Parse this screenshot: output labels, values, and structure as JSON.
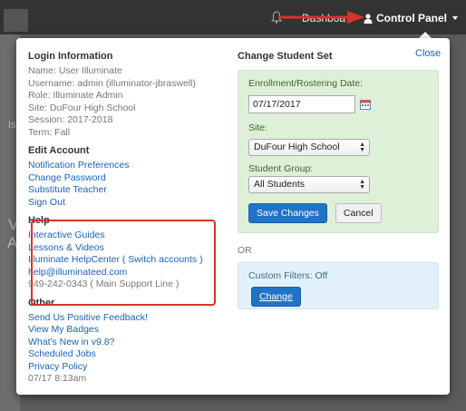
{
  "topbar": {
    "dashboard_label": "Dashboa",
    "control_panel_label": "Control Panel"
  },
  "background": {
    "snippet_is": "is",
    "snippet_v": "V",
    "snippet_a": "A"
  },
  "panel": {
    "close_label": "Close",
    "login": {
      "title": "Login Information",
      "name": "Name: User Illuminate",
      "username": "Username: admin (illuminator-jbraswell)",
      "role": "Role: Illuminate Admin",
      "site": "Site: DuFour High School",
      "session": "Session: 2017-2018",
      "term": "Term: Fall"
    },
    "edit_account": {
      "title": "Edit Account",
      "links": [
        "Notification Preferences",
        "Change Password",
        "Substitute Teacher",
        "Sign Out"
      ]
    },
    "help": {
      "title": "Help",
      "guides": "Interactive Guides",
      "lessons": "Lessons & Videos",
      "helpcenter": "Illuminate HelpCenter",
      "switch_accounts": "( Switch accounts )",
      "email": "help@illuminateed.com",
      "phone": "949-242-0343 ( Main Support Line )"
    },
    "other": {
      "title": "Other",
      "links": [
        "Send Us Positive Feedback!",
        "View My Badges",
        "What's New in v9.8?",
        "Scheduled Jobs",
        "Privacy Policy"
      ],
      "timestamp": "07/17 8:13am"
    },
    "student_set": {
      "title": "Change Student Set",
      "date_label": "Enrollment/Rostering Date:",
      "date_value": "07/17/2017",
      "site_label": "Site:",
      "site_value": "DuFour High School",
      "group_label": "Student Group:",
      "group_value": "All Students",
      "save_label": "Save Changes",
      "cancel_label": "Cancel"
    },
    "or_label": "OR",
    "custom_filters": {
      "label": "Custom Filters: Off",
      "change_label": "Change"
    }
  },
  "colors": {
    "link": "#1a63b4",
    "annotation": "#d9322b",
    "primary_button": "#2173c7"
  }
}
